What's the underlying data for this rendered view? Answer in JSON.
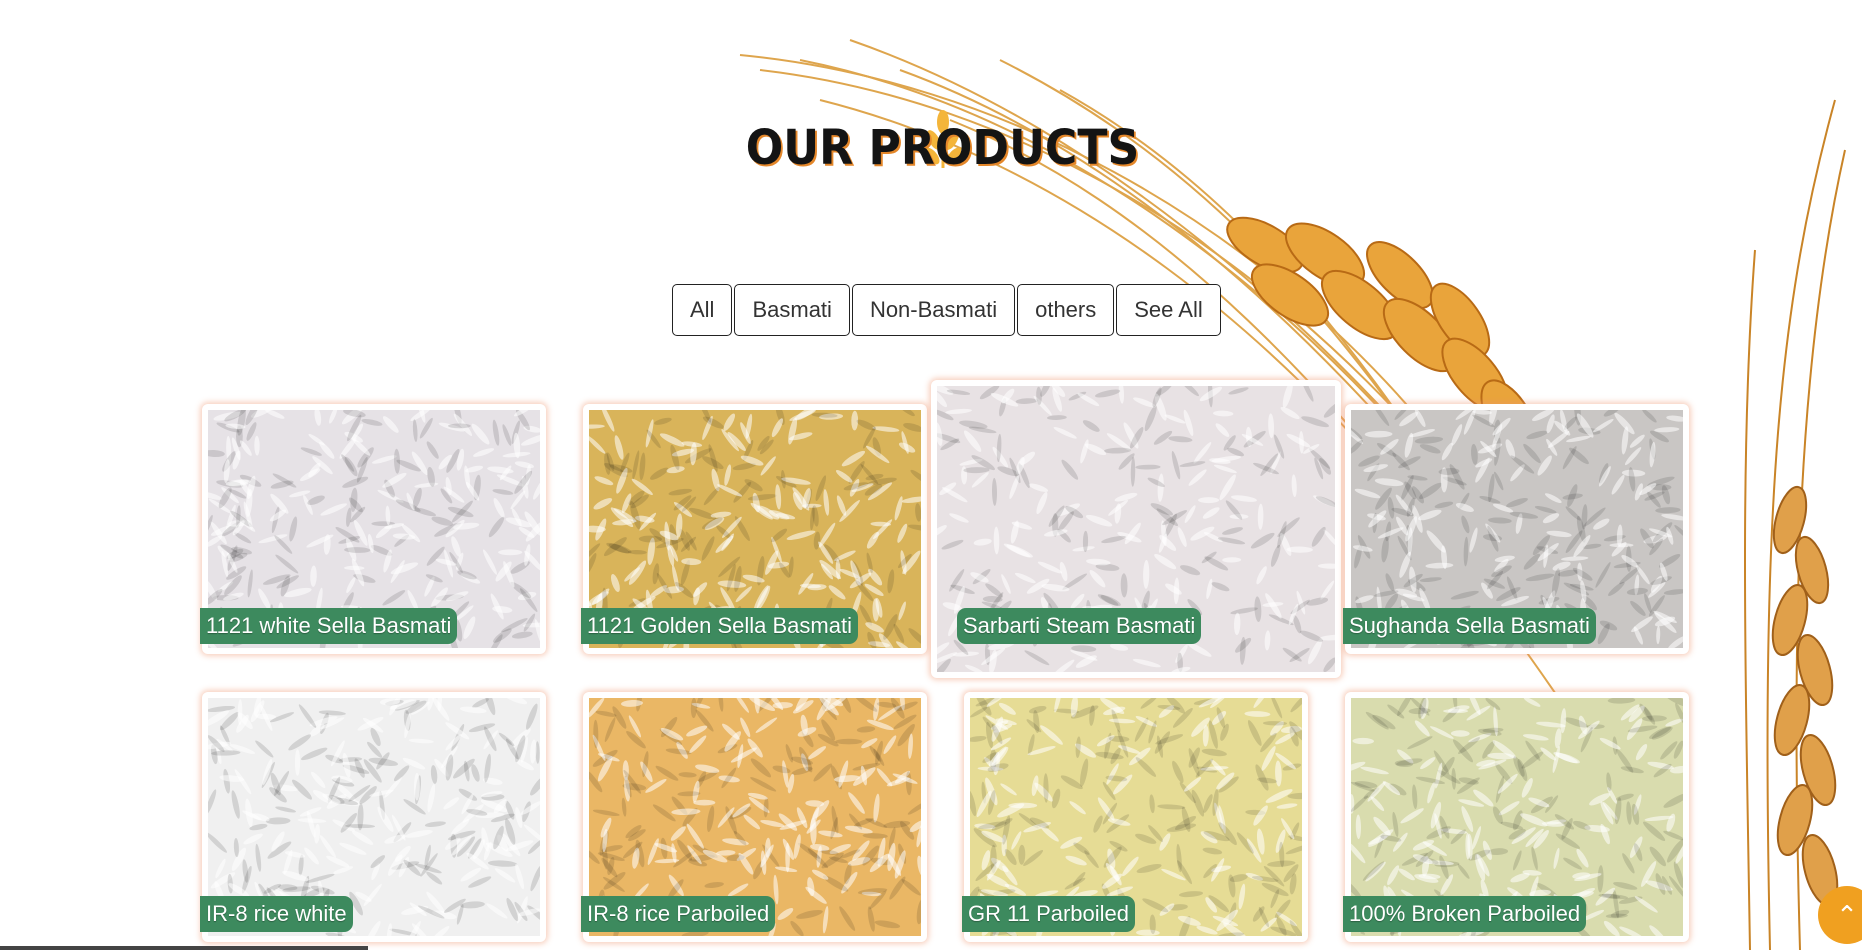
{
  "section": {
    "title": "OUR PRODUCTS"
  },
  "filters": [
    {
      "label": "All"
    },
    {
      "label": "Basmati"
    },
    {
      "label": "Non-Basmati"
    },
    {
      "label": "others"
    },
    {
      "label": "See All"
    }
  ],
  "products": [
    {
      "name": "1121 white Sella Basmati",
      "color": "#e6e2e6"
    },
    {
      "name": "1121 Golden Sella Basmati",
      "color": "#d9b45a"
    },
    {
      "name": "Sarbarti Steam Basmati",
      "color": "#e8e2e4"
    },
    {
      "name": "Sughanda Sella Basmati",
      "color": "#c9c6c4"
    },
    {
      "name": "IR-8 rice white",
      "color": "#f0f0f0"
    },
    {
      "name": "IR-8 rice Parboiled",
      "color": "#eab765"
    },
    {
      "name": "GR 11 Parboiled",
      "color": "#e6dc95"
    },
    {
      "name": "100% Broken Parboiled",
      "color": "#d9dcae"
    }
  ],
  "colors": {
    "label_bg": "#3d8a5e",
    "accent": "#f0a020",
    "title_shadow": "#e4872a"
  },
  "icons": {
    "title": "wheat-icon",
    "scroll": "chevron-up-icon"
  }
}
